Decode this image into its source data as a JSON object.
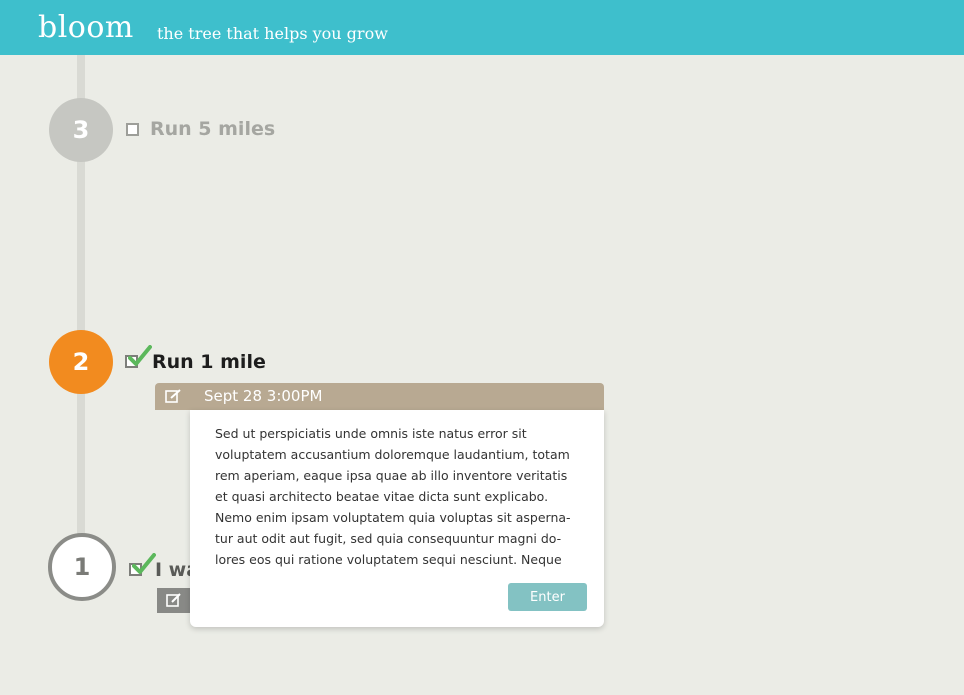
{
  "header": {
    "logo": "bloom",
    "tagline": "the tree that helps you grow"
  },
  "goals": [
    {
      "number": "3",
      "label": "Run 5 miles",
      "checked": false
    },
    {
      "number": "2",
      "label": "Run 1 mile",
      "checked": true
    },
    {
      "number": "1",
      "label": "I wa",
      "checked": true
    }
  ],
  "popup": {
    "date": "Sept 28 3:00PM",
    "lines": [
      "Sed ut perspiciatis unde omnis iste natus error sit",
      "voluptatem accusantium doloremque laudantium, totam",
      "rem aperiam, eaque ipsa quae ab illo inventore veritatis",
      "et quasi architecto beatae vitae dicta sunt explicabo.",
      "Nemo enim ipsam voluptatem quia voluptas sit asperna-",
      "tur aut odit aut fugit, sed quia consequuntur magni do-",
      "lores eos qui ratione voluptatem sequi nesciunt. Neque"
    ],
    "enter_label": "Enter"
  },
  "colors": {
    "header": "#3ebfcc",
    "background": "#ebece6",
    "active_node": "#f28b1f",
    "inactive_node": "#c6c7c2",
    "popup_tab": "#b8a992",
    "enter_button": "#83c2c3",
    "check": "#5cb85c"
  },
  "icons": [
    "edit-icon",
    "checkmark-icon",
    "checkbox-icon"
  ]
}
